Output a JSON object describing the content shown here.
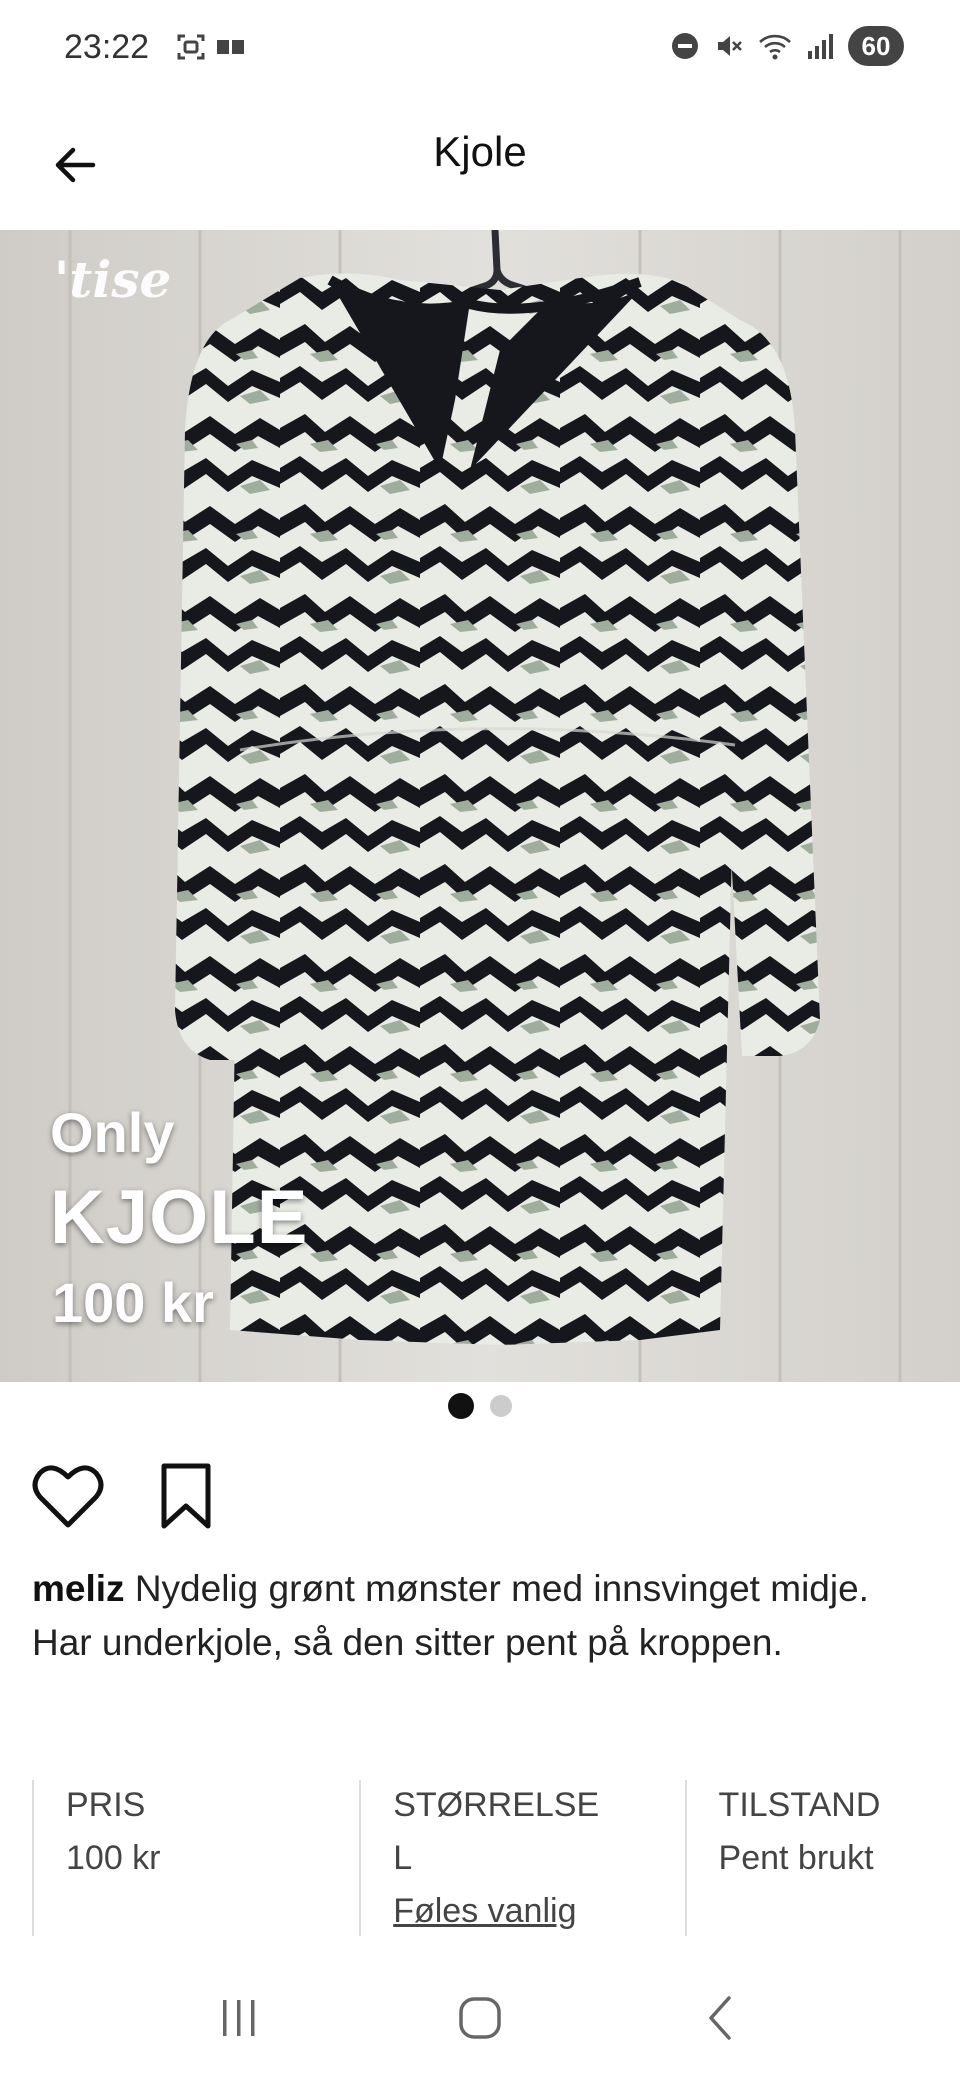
{
  "status_bar": {
    "time": "23:22",
    "battery": "60"
  },
  "header": {
    "title": "Kjole"
  },
  "photo": {
    "watermark": "'tise",
    "brand": "Only",
    "title": "KJOLE",
    "price": "100 kr",
    "page_count": 2,
    "current_page": 1
  },
  "post": {
    "username": "meliz",
    "description": "Nydelig grønt mønster med innsvinget midje. Har underkjole, så den sitter pent på kroppen."
  },
  "details": {
    "price_label": "PRIS",
    "price_value": "100 kr",
    "size_label": "STØRRELSE",
    "size_value": "L",
    "size_fit_link": "Føles vanlig",
    "condition_label": "TILSTAND",
    "condition_value": "Pent brukt"
  },
  "colors": {
    "dress_dark": "#15171c",
    "dress_light": "#e9ebe5",
    "dress_green": "#9fad9d",
    "wall": "#d9d7d3"
  }
}
